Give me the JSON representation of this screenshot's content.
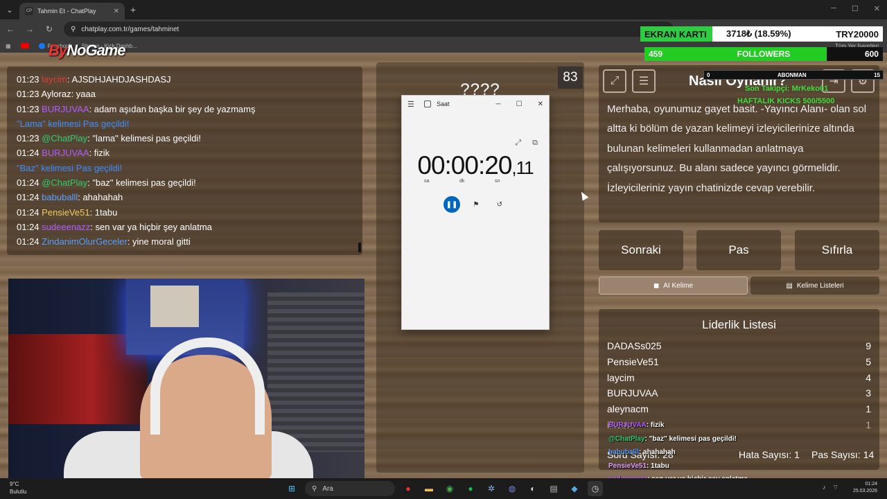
{
  "browser": {
    "tab_favicon": "CP",
    "tab_title": "Tahmin Et - ChatPlay",
    "url": "chatplay.com.tr/games/tahminet",
    "bookmarks": [
      "Facebook",
      "Stream - Kick Dashb..."
    ],
    "bookmarks_right": "Tüm Yer İşaretleri"
  },
  "overlay": {
    "logo_a": "By",
    "logo_b": "NoGame",
    "ekran_label": "EKRAN KARTI",
    "ekran_value": "3718₺ (18.59%)",
    "ekran_goal": "TRY20000",
    "followers_current": "459",
    "followers_label": "FOLLOWERS",
    "followers_goal": "600",
    "followers_progress": 0.765,
    "sub_current": "0",
    "sub_label": "ABONMAN",
    "sub_goal": "15",
    "last_follower": "Son Takipçi: MrKeko01",
    "kick_text": "HAFTALIK KICKS 500/5500",
    "chat_lines": [
      {
        "user": "BURJUVAA",
        "msg": ": fizik",
        "color": "#b05cff"
      },
      {
        "user": "@ChatPlay",
        "msg": ": \"baz\" kelimesi pas geçildi!",
        "color": "#2ecc71"
      },
      {
        "user": "babuballl",
        "msg": ": ahahahah",
        "color": "#5aa0ff"
      },
      {
        "user": "PensieVe51",
        "msg": ": 1tabu",
        "color": "#e6a0ff"
      },
      {
        "user": "sudeeenazz",
        "msg": ": sen var ya hiçbir şey anlatma",
        "color": "#b05cff"
      },
      {
        "user": "ZindanimOlurGeceler",
        "msg": ": yine moral gitti",
        "color": "#5aa0ff"
      }
    ]
  },
  "chat": [
    {
      "time": "01:23",
      "user": "laycim",
      "msg": ": AJSDHJAHDJASHDASJ",
      "color": "#e23c3c"
    },
    {
      "time": "01:23",
      "user": "Ayloraz",
      "msg": ": yaaa",
      "color": "#ffffff"
    },
    {
      "time": "01:23",
      "user": "BURJUVAA",
      "msg": ": adam aşıdan başka bir şey de yazmamş",
      "color": "#b05cff"
    },
    {
      "time": "",
      "user": "\"Lama\" kelimesi Pas geçildi!",
      "msg": "",
      "color": "#3d8bff",
      "system": true
    },
    {
      "time": "01:23",
      "user": "@ChatPlay",
      "msg": ": \"lama\" kelimesi pas geçildi!",
      "color": "#2ecc71"
    },
    {
      "time": "01:24",
      "user": "BURJUVAA",
      "msg": ": fizik",
      "color": "#b05cff"
    },
    {
      "time": "",
      "user": "\"Baz\" kelimesi Pas geçildi!",
      "msg": "",
      "color": "#3d8bff",
      "system": true
    },
    {
      "time": "01:24",
      "user": "@ChatPlay",
      "msg": ": \"baz\" kelimesi pas geçildi!",
      "color": "#2ecc71"
    },
    {
      "time": "01:24",
      "user": "babuballl",
      "msg": ": ahahahah",
      "color": "#5aa0ff"
    },
    {
      "time": "01:24",
      "user": "PensieVe51",
      "msg": ": 1tabu",
      "color": "#f0d060"
    },
    {
      "time": "01:24",
      "user": "sudeeenazz",
      "msg": ": sen var ya hiçbir şey anlatma",
      "color": "#b05cff"
    },
    {
      "time": "01:24",
      "user": "ZindanimOlurGeceler",
      "msg": ": yine moral gitti",
      "color": "#5aa0ff"
    }
  ],
  "game": {
    "word": "????",
    "timer": "83"
  },
  "stopwatch": {
    "title": "Saat",
    "time_main": "00:00:20",
    "time_ms": ",11",
    "unit_h": "sa",
    "unit_m": "dk",
    "unit_s": "sn"
  },
  "info": {
    "title": "Nasıl Oynanır?",
    "text": "Merhaba, oyunumuz gayet basit. -Yayıncı Alanı- olan sol altta ki bölüm de yazan kelimeyi izleyicilerinize altında bulunan kelimeleri kullanmadan anlatmaya çalışıyorsunuz. Bu alanı sadece yayıncı görmelidir. İzleyicileriniz yayın chatinizde cevap verebilir."
  },
  "buttons": {
    "next": "Sonraki",
    "pass": "Pas",
    "reset": "Sıfırla",
    "ai_word": "AI Kelime",
    "word_lists": "Kelime Listeleri"
  },
  "leaderboard": {
    "title": "Liderlik Listesi",
    "rows": [
      {
        "name": "DADASs025",
        "score": "9"
      },
      {
        "name": "PensieVe51",
        "score": "5"
      },
      {
        "name": "laycim",
        "score": "4"
      },
      {
        "name": "BURJUVAA",
        "score": "3"
      },
      {
        "name": "aleynacm",
        "score": "1"
      },
      {
        "name": "ilkeert",
        "score": "1"
      }
    ],
    "question_count": "Soru Sayısı: 28",
    "error_count": "Hata Sayısı: 1",
    "pass_count": "Pas Sayısı: 14"
  },
  "taskbar": {
    "temp": "9°C",
    "weather": "Bulutlu",
    "search": "Ara",
    "time": "01:24",
    "date": "25.03.2026"
  }
}
